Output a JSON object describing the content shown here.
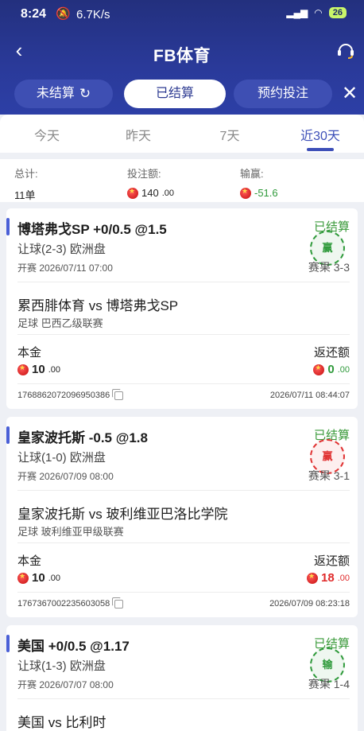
{
  "status_bar": {
    "time": "8:24",
    "bell_icon": "bell-off-icon",
    "speed": "6.7K/s",
    "battery": "26"
  },
  "navbar": {
    "title": "FB体育",
    "back_icon": "chevron-left-icon",
    "support_icon": "headset-icon"
  },
  "top_tabs": {
    "unsettled": "未结算",
    "settled": "已结算",
    "reserved": "预约投注",
    "active": "已结算"
  },
  "period_tabs": {
    "items": [
      "今天",
      "昨天",
      "7天",
      "近30天"
    ],
    "active": "近30天"
  },
  "summary": {
    "total_label": "总计:",
    "total_value": "11单",
    "stake_label": "投注额:",
    "stake_int": "140",
    "stake_dec": ".00",
    "pnl_label": "输赢:",
    "pnl_value": "-51.6"
  },
  "bets": [
    {
      "pick": "博塔弗戈SP +0/0.5 @1.5",
      "status": "已结算",
      "market": "让球(2-3) 欧洲盘",
      "kickoff": "开赛 2026/07/11 07:00",
      "score": "赛果 3-3",
      "stamp": "赢",
      "stamp_color": "#2f9a3b",
      "match": "累西腓体育 vs 博塔弗戈SP",
      "league": "足球  巴西乙级联赛",
      "stake_label": "本金",
      "stake_int": "10",
      "stake_dec": ".00",
      "return_label": "返还额",
      "return_int": "0",
      "return_dec": ".00",
      "return_color": "#2f9a3b",
      "order_id": "1768862072096950386",
      "settled_at": "2026/07/11 08:44:07"
    },
    {
      "pick": "皇家波托斯 -0.5 @1.8",
      "status": "已结算",
      "market": "让球(1-0) 欧洲盘",
      "kickoff": "开赛 2026/07/09 08:00",
      "score": "赛果 3-1",
      "stamp": "赢",
      "stamp_color": "#e03131",
      "match": "皇家波托斯 vs 玻利维亚巴洛比学院",
      "league": "足球  玻利维亚甲级联赛",
      "stake_label": "本金",
      "stake_int": "10",
      "stake_dec": ".00",
      "return_label": "返还额",
      "return_int": "18",
      "return_dec": ".00",
      "return_color": "#e02b2b",
      "order_id": "1767367002235603058",
      "settled_at": "2026/07/09 08:23:18"
    },
    {
      "pick": "美国 +0/0.5 @1.17",
      "status": "已结算",
      "market": "让球(1-3) 欧洲盘",
      "kickoff": "开赛 2026/07/07 08:00",
      "score": "赛果 1-4",
      "stamp": "输",
      "stamp_color": "#2f9a3b",
      "match": "美国 vs 比利时"
    }
  ],
  "colors": {
    "header": "#23307e",
    "accent": "#3d4fb8",
    "win_green": "#2f9a3b",
    "red": "#e02b2b"
  }
}
